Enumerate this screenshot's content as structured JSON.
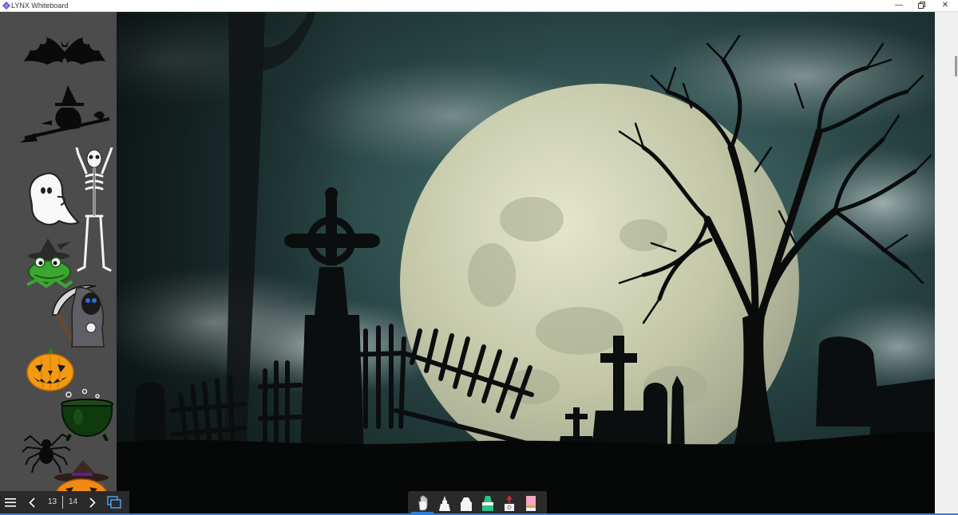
{
  "window": {
    "title": "LYNX Whiteboard",
    "controls": [
      "minimize-icon",
      "restore-icon",
      "close-icon"
    ]
  },
  "stickers": [
    "bat",
    "witch-on-broom",
    "ghost",
    "skeleton",
    "frog-in-witch-hat",
    "grim-reaper",
    "jack-o-lantern",
    "cauldron",
    "spider",
    "pumpkin-in-witch-hat"
  ],
  "canvas": {
    "background": "graveyard-full-moon-night-scene"
  },
  "navigation": {
    "menu_icon": "hamburger-menu-icon",
    "prev_icon": "chevron-left-icon",
    "current_page": "13",
    "total_pages": "14",
    "next_icon": "chevron-right-icon",
    "pages_icon": "page-overview-icon"
  },
  "tools": [
    {
      "name": "hand-select-tool",
      "active": true
    },
    {
      "name": "pen-tool",
      "active": false
    },
    {
      "name": "marker-tool",
      "active": false
    },
    {
      "name": "highlighter-tool",
      "active": false
    },
    {
      "name": "stamp-tool",
      "active": false
    },
    {
      "name": "eraser-tool",
      "active": false
    }
  ],
  "colors": {
    "accent": "#2f7fe0",
    "panel": "#4c4c4c",
    "toolbar": "#2a2a2a",
    "highlighter": "#2fc089",
    "eraser": "#f4a7c2",
    "stamp": "#d8242f"
  }
}
